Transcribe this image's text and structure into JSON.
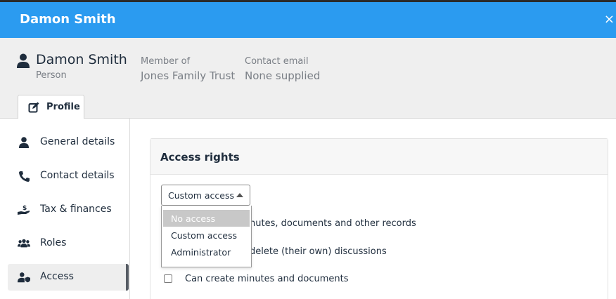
{
  "titlebar": {
    "title": "Damon Smith",
    "close": "×"
  },
  "header": {
    "person_name": "Damon Smith",
    "person_type": "Person",
    "member_of_label": "Member of",
    "member_of_value": "Jones Family Trust",
    "contact_email_label": "Contact email",
    "contact_email_value": "None supplied"
  },
  "tabs": [
    {
      "label": "Profile",
      "icon": "edit-icon"
    }
  ],
  "sidebar": {
    "items": [
      {
        "label": "General details",
        "icon": "person-icon"
      },
      {
        "label": "Contact details",
        "icon": "phone-icon"
      },
      {
        "label": "Tax & finances",
        "icon": "hand-dollar-icon"
      },
      {
        "label": "Roles",
        "icon": "users-icon"
      },
      {
        "label": "Access",
        "icon": "user-lock-icon",
        "active": true
      }
    ]
  },
  "access": {
    "title": "Access rights",
    "select_value": "Custom access",
    "options": [
      {
        "label": "No access",
        "disabled": true
      },
      {
        "label": "Custom access"
      },
      {
        "label": "Administrator"
      }
    ],
    "permissions": [
      "nutes, documents and other records",
      "delete (their own) discussions",
      "Can create minutes and documents"
    ]
  },
  "colors": {
    "titlebar": "#2b9bf0",
    "header_bg": "#efefef",
    "active_indicator": "#555b63"
  }
}
